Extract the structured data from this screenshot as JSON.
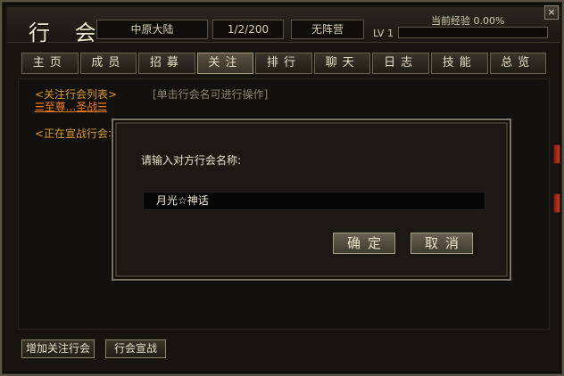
{
  "window": {
    "title": "行 会",
    "close_label": "×"
  },
  "header": {
    "region": "中原大陆",
    "count": "1/2/200",
    "camp": "无阵营",
    "level": "LV 1",
    "exp_label": "当前经验 0.00%",
    "exp_percent": 0
  },
  "tabs": [
    {
      "label": "主页",
      "active": false
    },
    {
      "label": "成员",
      "active": false
    },
    {
      "label": "招募",
      "active": false
    },
    {
      "label": "关注",
      "active": true
    },
    {
      "label": "排行",
      "active": false
    },
    {
      "label": "聊天",
      "active": false
    },
    {
      "label": "日志",
      "active": false
    },
    {
      "label": "技能",
      "active": false
    },
    {
      "label": "总览",
      "active": false
    }
  ],
  "content": {
    "followed_title": "<关注行会列表>",
    "followed_items": [
      "☰至尊...圣战☰"
    ],
    "hint": "[单击行会名可进行操作]",
    "war_title": "<正在宣战行会>"
  },
  "dialog": {
    "prompt": "请输入对方行会名称:",
    "input_value": "月光☆神话",
    "confirm_label": "确定",
    "cancel_label": "取消"
  },
  "bottom": {
    "add_follow_label": "增加关注行会",
    "declare_war_label": "行会宣战"
  },
  "colors": {
    "accent_orange": "#d99a33",
    "link_orange": "#f07a1e",
    "marker_red": "#c63a1a"
  }
}
